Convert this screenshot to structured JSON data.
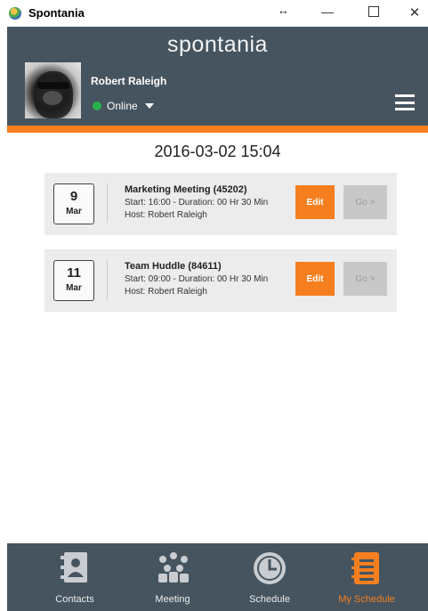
{
  "window": {
    "title": "Spontania",
    "resize_glyph": "↔",
    "minimize_glyph": "—",
    "close_glyph": "✕"
  },
  "header": {
    "logo": "spontania",
    "user_name": "Robert Raleigh",
    "status": "Online",
    "accent_color": "#f57f1f",
    "header_color": "#46545f"
  },
  "current_datetime": "2016-03-02 15:04",
  "meetings": [
    {
      "day": "9",
      "month": "Mar",
      "title": "Marketing Meeting (45202)",
      "start": "Start: 16:00 - Duration: 00 Hr 30 Min",
      "host": "Host: Robert Raleigh",
      "edit_label": "Edit",
      "go_label": "Go >"
    },
    {
      "day": "11",
      "month": "Mar",
      "title": "Team Huddle (84611)",
      "start": "Start: 09:00 - Duration: 00 Hr 30 Min",
      "host": "Host: Robert Raleigh",
      "edit_label": "Edit",
      "go_label": "Go >"
    }
  ],
  "nav": [
    {
      "label": "Contacts",
      "icon": "contacts-icon"
    },
    {
      "label": "Meeting",
      "icon": "meeting-icon"
    },
    {
      "label": "Schedule",
      "icon": "schedule-icon"
    },
    {
      "label": "My Schedule",
      "icon": "my-schedule-icon",
      "active": true
    }
  ]
}
